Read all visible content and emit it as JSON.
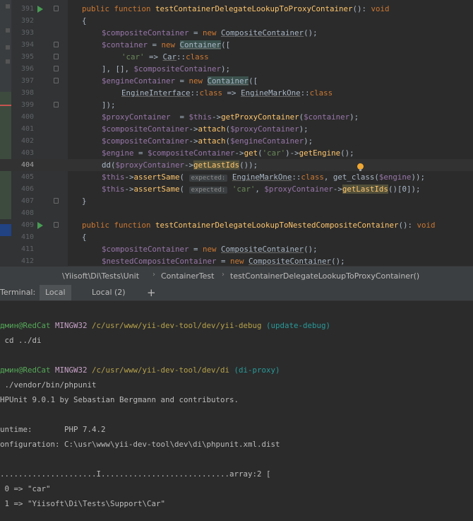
{
  "editor": {
    "lines": [
      {
        "num": "391",
        "run": true,
        "fold": true,
        "indent": 1,
        "tokens": [
          [
            "kw",
            "public function "
          ],
          [
            "fn",
            "testContainerDelegateLookupToProxyContainer"
          ],
          [
            "p",
            "(): "
          ],
          [
            "kw",
            "void"
          ]
        ]
      },
      {
        "num": "392",
        "indent": 1,
        "tokens": [
          [
            "p",
            "{"
          ]
        ]
      },
      {
        "num": "393",
        "indent": 2,
        "tokens": [
          [
            "var",
            "$compositeContainer"
          ],
          [
            "p",
            " = "
          ],
          [
            "kw",
            "new "
          ],
          [
            "cls",
            "CompositeContainer"
          ],
          [
            "p",
            "();"
          ]
        ]
      },
      {
        "num": "394",
        "fold": true,
        "indent": 2,
        "tokens": [
          [
            "var",
            "$container"
          ],
          [
            "p",
            " = "
          ],
          [
            "kw",
            "new "
          ],
          [
            "clsh",
            "Container"
          ],
          [
            "p",
            "(["
          ]
        ]
      },
      {
        "num": "395",
        "fold": true,
        "indent": 3,
        "tokens": [
          [
            "str",
            "'car'"
          ],
          [
            "p",
            " => "
          ],
          [
            "cls",
            "Car"
          ],
          [
            "p",
            "::"
          ],
          [
            "kw",
            "class"
          ]
        ]
      },
      {
        "num": "396",
        "fold": true,
        "indent": 2,
        "tokens": [
          [
            "p",
            "], [], "
          ],
          [
            "var",
            "$compositeContainer"
          ],
          [
            "p",
            ");"
          ]
        ]
      },
      {
        "num": "397",
        "fold": true,
        "indent": 2,
        "tokens": [
          [
            "var",
            "$engineContainer"
          ],
          [
            "p",
            " = "
          ],
          [
            "kw",
            "new "
          ],
          [
            "clsh",
            "Container"
          ],
          [
            "p",
            "(["
          ]
        ]
      },
      {
        "num": "398",
        "indent": 3,
        "tokens": [
          [
            "cls",
            "EngineInterface"
          ],
          [
            "p",
            "::"
          ],
          [
            "kw",
            "class"
          ],
          [
            "p",
            " => "
          ],
          [
            "cls",
            "EngineMarkOne"
          ],
          [
            "p",
            "::"
          ],
          [
            "kw",
            "class"
          ]
        ]
      },
      {
        "num": "399",
        "fold": true,
        "indent": 2,
        "tokens": [
          [
            "p",
            "]);"
          ]
        ]
      },
      {
        "num": "400",
        "indent": 2,
        "tokens": [
          [
            "var",
            "$proxyContainer"
          ],
          [
            "p",
            "  = "
          ],
          [
            "var",
            "$this"
          ],
          [
            "p",
            "->"
          ],
          [
            "call",
            "getProxyContainer"
          ],
          [
            "p",
            "("
          ],
          [
            "var",
            "$container"
          ],
          [
            "p",
            ");"
          ]
        ]
      },
      {
        "num": "401",
        "indent": 2,
        "tokens": [
          [
            "var",
            "$compositeContainer"
          ],
          [
            "p",
            "->"
          ],
          [
            "call",
            "attach"
          ],
          [
            "p",
            "("
          ],
          [
            "var",
            "$proxyContainer"
          ],
          [
            "p",
            ");"
          ]
        ]
      },
      {
        "num": "402",
        "indent": 2,
        "tokens": [
          [
            "var",
            "$compositeContainer"
          ],
          [
            "p",
            "->"
          ],
          [
            "call",
            "attach"
          ],
          [
            "p",
            "("
          ],
          [
            "var",
            "$engineContainer"
          ],
          [
            "p",
            ");"
          ]
        ]
      },
      {
        "num": "403",
        "indent": 2,
        "tokens": [
          [
            "var",
            "$engine"
          ],
          [
            "p",
            " = "
          ],
          [
            "var",
            "$compositeContainer"
          ],
          [
            "p",
            "->"
          ],
          [
            "call",
            "get"
          ],
          [
            "p",
            "("
          ],
          [
            "str",
            "'car'"
          ],
          [
            "p",
            ")->"
          ],
          [
            "call",
            "getEngine"
          ],
          [
            "p",
            "();"
          ]
        ]
      },
      {
        "num": "404",
        "current": true,
        "indent": 2,
        "tokens": [
          [
            "p",
            "dd("
          ],
          [
            "var",
            "$proxyContainer"
          ],
          [
            "p",
            "->"
          ],
          [
            "callh",
            "getLastIds"
          ],
          [
            "p",
            "());"
          ]
        ]
      },
      {
        "num": "405",
        "indent": 2,
        "tokens": [
          [
            "var",
            "$this"
          ],
          [
            "p",
            "->"
          ],
          [
            "call",
            "assertSame"
          ],
          [
            "p",
            "( "
          ],
          [
            "hint",
            "expected:"
          ],
          [
            "p",
            " "
          ],
          [
            "cls",
            "EngineMarkOne"
          ],
          [
            "p",
            "::"
          ],
          [
            "kw",
            "class"
          ],
          [
            "p",
            ", get_class("
          ],
          [
            "var",
            "$engine"
          ],
          [
            "p",
            "));"
          ]
        ]
      },
      {
        "num": "406",
        "indent": 2,
        "tokens": [
          [
            "var",
            "$this"
          ],
          [
            "p",
            "->"
          ],
          [
            "call",
            "assertSame"
          ],
          [
            "p",
            "( "
          ],
          [
            "hint",
            "expected:"
          ],
          [
            "p",
            " "
          ],
          [
            "str",
            "'car'"
          ],
          [
            "p",
            ", "
          ],
          [
            "var",
            "$proxyContainer"
          ],
          [
            "p",
            "->"
          ],
          [
            "callh",
            "getLastIds"
          ],
          [
            "p",
            "()[0]);"
          ]
        ]
      },
      {
        "num": "407",
        "fold": true,
        "indent": 1,
        "tokens": [
          [
            "p",
            "}"
          ]
        ]
      },
      {
        "num": "408",
        "indent": 1,
        "tokens": []
      },
      {
        "num": "409",
        "run": true,
        "fold": true,
        "indent": 1,
        "tokens": [
          [
            "kw",
            "public function "
          ],
          [
            "fn",
            "testContainerDelegateLookupToNestedCompositeContainer"
          ],
          [
            "p",
            "(): "
          ],
          [
            "kw",
            "void"
          ]
        ]
      },
      {
        "num": "410",
        "indent": 1,
        "tokens": [
          [
            "p",
            "{"
          ]
        ]
      },
      {
        "num": "411",
        "indent": 2,
        "tokens": [
          [
            "var",
            "$compositeContainer"
          ],
          [
            "p",
            " = "
          ],
          [
            "kw",
            "new "
          ],
          [
            "cls",
            "CompositeContainer"
          ],
          [
            "p",
            "();"
          ]
        ]
      },
      {
        "num": "412",
        "indent": 2,
        "tokens": [
          [
            "var",
            "$nestedCompositeContainer"
          ],
          [
            "p",
            " = "
          ],
          [
            "kw",
            "new "
          ],
          [
            "cls",
            "CompositeContainer"
          ],
          [
            "p",
            "();"
          ]
        ]
      }
    ]
  },
  "breadcrumb": {
    "items": [
      "\\Yiisoft\\Di\\Tests\\Unit",
      "ContainerTest",
      "testContainerDelegateLookupToProxyContainer()"
    ],
    "separator": "›"
  },
  "terminal_tabs": {
    "label": "Terminal:",
    "tabs": [
      "Local",
      "Local (2)"
    ],
    "add_label": "+"
  },
  "terminal": {
    "lines": [
      {
        "text": ""
      },
      {
        "parts": [
          [
            "u",
            "дмин@RedCat "
          ],
          [
            "m",
            "MINGW32 "
          ],
          [
            "y",
            "/c/usr/www/yii-dev-tool/dev/yii-debug "
          ],
          [
            "c",
            "(update-debug)"
          ]
        ]
      },
      {
        "text": " cd ../di"
      },
      {
        "text": ""
      },
      {
        "parts": [
          [
            "u",
            "дмин@RedCat "
          ],
          [
            "m",
            "MINGW32 "
          ],
          [
            "y",
            "/c/usr/www/yii-dev-tool/dev/di "
          ],
          [
            "c",
            "(di-proxy)"
          ]
        ]
      },
      {
        "text": " ./vendor/bin/phpunit"
      },
      {
        "text": "HPUnit 9.0.1 by Sebastian Bergmann and contributors."
      },
      {
        "text": ""
      },
      {
        "text": "untime:       PHP 7.4.2"
      },
      {
        "text": "onfiguration: C:\\usr\\www\\yii-dev-tool\\dev\\di\\phpunit.xml.dist"
      },
      {
        "text": ""
      },
      {
        "text": ".....................I............................array:2 ["
      },
      {
        "text": " 0 => \"car\""
      },
      {
        "text": " 1 => \"Yiisoft\\Di\\Tests\\Support\\Car\""
      }
    ]
  },
  "colors": {
    "background": "#2b2b2b",
    "keyword": "#cc7832",
    "function": "#ffc66d",
    "variable": "#9876aa",
    "string": "#6a8759",
    "run_icon": "#499c54"
  }
}
